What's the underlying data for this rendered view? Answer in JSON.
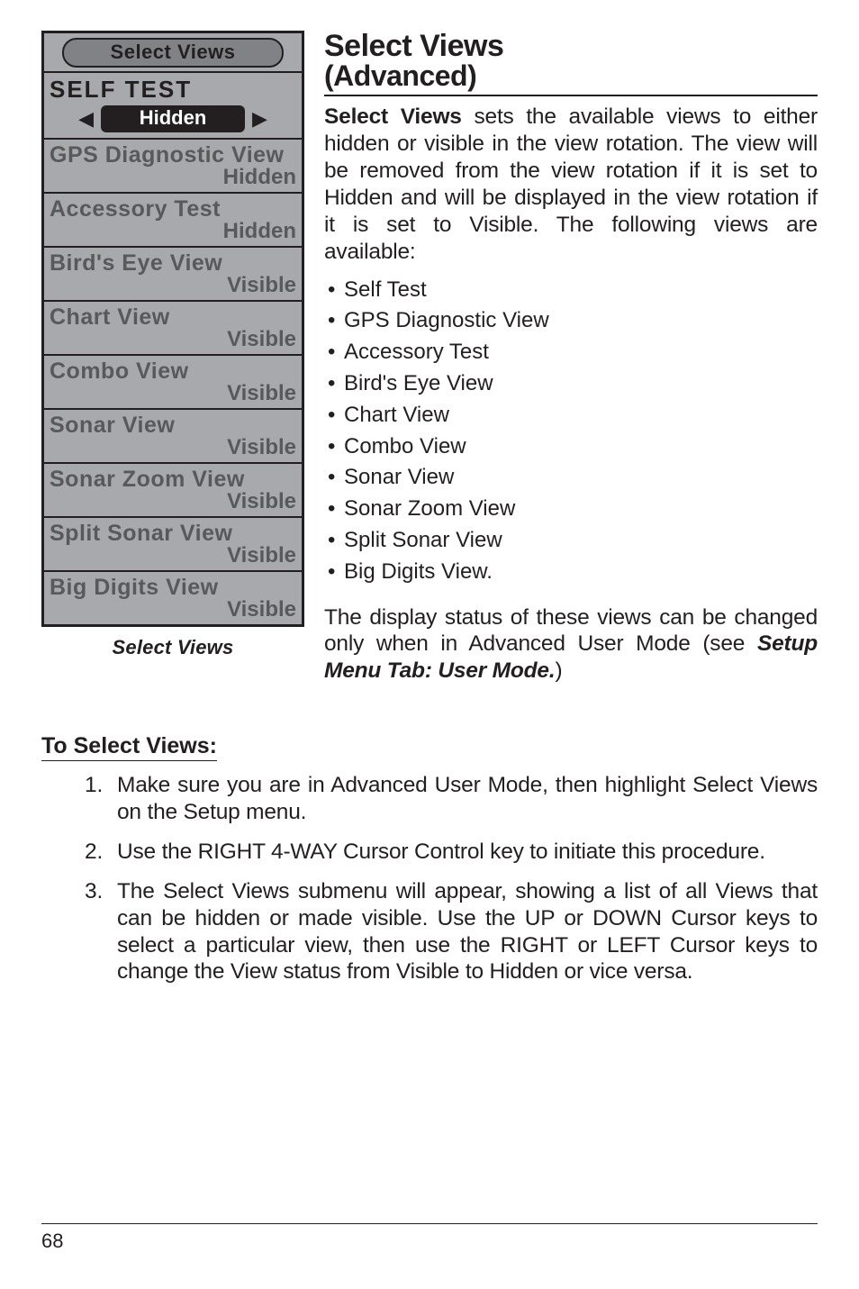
{
  "lcd": {
    "title": "Select Views",
    "selected": {
      "label": "SELF TEST",
      "value": "Hidden"
    },
    "rows": [
      {
        "label": "GPS Diagnostic View",
        "value": "Hidden"
      },
      {
        "label": "Accessory Test",
        "value": "Hidden"
      },
      {
        "label": "Bird's Eye View",
        "value": "Visible"
      },
      {
        "label": "Chart View",
        "value": "Visible"
      },
      {
        "label": "Combo View",
        "value": "Visible"
      },
      {
        "label": "Sonar View",
        "value": "Visible"
      },
      {
        "label": "Sonar Zoom View",
        "value": "Visible"
      },
      {
        "label": "Split Sonar View",
        "value": "Visible"
      },
      {
        "label": "Big Digits View",
        "value": "Visible"
      }
    ],
    "caption": "Select Views"
  },
  "heading": {
    "main": "Select Views",
    "sub": "(Advanced)"
  },
  "intro": {
    "lead": "Select Views",
    "rest": " sets the available views to either hidden or visible in the view rotation.  The view will be removed from the view rotation if it is set to Hidden and will be displayed in the view rotation if it is set to Visible. The following views are available:"
  },
  "bullets": [
    "Self Test",
    "GPS Diagnostic View",
    "Accessory Test",
    "Bird's Eye View",
    "Chart View",
    "Combo View",
    "Sonar View",
    "Sonar Zoom View",
    "Split Sonar View",
    "Big Digits View."
  ],
  "note": {
    "pre": "The display status of these views can be changed only when in Advanced User Mode (see ",
    "ref": "Setup Menu Tab: User Mode.",
    "post": ")"
  },
  "subhead": "To Select Views:",
  "steps": [
    "Make sure you are in Advanced User Mode, then highlight Select Views on the Setup menu.",
    "Use the RIGHT 4-WAY Cursor Control key to initiate this procedure.",
    "The Select Views submenu will appear, showing a list of all Views that can be hidden or made visible. Use the UP or DOWN Cursor keys to select a particular view, then use the RIGHT or LEFT Cursor keys to change the View status from Visible to Hidden or vice versa."
  ],
  "page": "68"
}
